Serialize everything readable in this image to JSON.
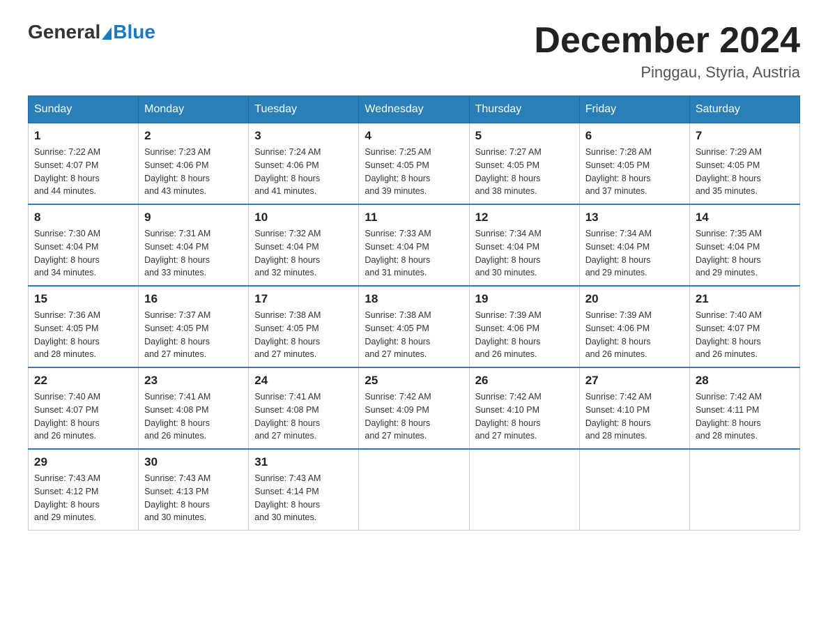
{
  "header": {
    "logo_general": "General",
    "logo_blue": "Blue",
    "month_title": "December 2024",
    "location": "Pinggau, Styria, Austria"
  },
  "days_of_week": [
    "Sunday",
    "Monday",
    "Tuesday",
    "Wednesday",
    "Thursday",
    "Friday",
    "Saturday"
  ],
  "weeks": [
    [
      {
        "day": "1",
        "sunrise": "7:22 AM",
        "sunset": "4:07 PM",
        "daylight": "8 hours and 44 minutes."
      },
      {
        "day": "2",
        "sunrise": "7:23 AM",
        "sunset": "4:06 PM",
        "daylight": "8 hours and 43 minutes."
      },
      {
        "day": "3",
        "sunrise": "7:24 AM",
        "sunset": "4:06 PM",
        "daylight": "8 hours and 41 minutes."
      },
      {
        "day": "4",
        "sunrise": "7:25 AM",
        "sunset": "4:05 PM",
        "daylight": "8 hours and 39 minutes."
      },
      {
        "day": "5",
        "sunrise": "7:27 AM",
        "sunset": "4:05 PM",
        "daylight": "8 hours and 38 minutes."
      },
      {
        "day": "6",
        "sunrise": "7:28 AM",
        "sunset": "4:05 PM",
        "daylight": "8 hours and 37 minutes."
      },
      {
        "day": "7",
        "sunrise": "7:29 AM",
        "sunset": "4:05 PM",
        "daylight": "8 hours and 35 minutes."
      }
    ],
    [
      {
        "day": "8",
        "sunrise": "7:30 AM",
        "sunset": "4:04 PM",
        "daylight": "8 hours and 34 minutes."
      },
      {
        "day": "9",
        "sunrise": "7:31 AM",
        "sunset": "4:04 PM",
        "daylight": "8 hours and 33 minutes."
      },
      {
        "day": "10",
        "sunrise": "7:32 AM",
        "sunset": "4:04 PM",
        "daylight": "8 hours and 32 minutes."
      },
      {
        "day": "11",
        "sunrise": "7:33 AM",
        "sunset": "4:04 PM",
        "daylight": "8 hours and 31 minutes."
      },
      {
        "day": "12",
        "sunrise": "7:34 AM",
        "sunset": "4:04 PM",
        "daylight": "8 hours and 30 minutes."
      },
      {
        "day": "13",
        "sunrise": "7:34 AM",
        "sunset": "4:04 PM",
        "daylight": "8 hours and 29 minutes."
      },
      {
        "day": "14",
        "sunrise": "7:35 AM",
        "sunset": "4:04 PM",
        "daylight": "8 hours and 29 minutes."
      }
    ],
    [
      {
        "day": "15",
        "sunrise": "7:36 AM",
        "sunset": "4:05 PM",
        "daylight": "8 hours and 28 minutes."
      },
      {
        "day": "16",
        "sunrise": "7:37 AM",
        "sunset": "4:05 PM",
        "daylight": "8 hours and 27 minutes."
      },
      {
        "day": "17",
        "sunrise": "7:38 AM",
        "sunset": "4:05 PM",
        "daylight": "8 hours and 27 minutes."
      },
      {
        "day": "18",
        "sunrise": "7:38 AM",
        "sunset": "4:05 PM",
        "daylight": "8 hours and 27 minutes."
      },
      {
        "day": "19",
        "sunrise": "7:39 AM",
        "sunset": "4:06 PM",
        "daylight": "8 hours and 26 minutes."
      },
      {
        "day": "20",
        "sunrise": "7:39 AM",
        "sunset": "4:06 PM",
        "daylight": "8 hours and 26 minutes."
      },
      {
        "day": "21",
        "sunrise": "7:40 AM",
        "sunset": "4:07 PM",
        "daylight": "8 hours and 26 minutes."
      }
    ],
    [
      {
        "day": "22",
        "sunrise": "7:40 AM",
        "sunset": "4:07 PM",
        "daylight": "8 hours and 26 minutes."
      },
      {
        "day": "23",
        "sunrise": "7:41 AM",
        "sunset": "4:08 PM",
        "daylight": "8 hours and 26 minutes."
      },
      {
        "day": "24",
        "sunrise": "7:41 AM",
        "sunset": "4:08 PM",
        "daylight": "8 hours and 27 minutes."
      },
      {
        "day": "25",
        "sunrise": "7:42 AM",
        "sunset": "4:09 PM",
        "daylight": "8 hours and 27 minutes."
      },
      {
        "day": "26",
        "sunrise": "7:42 AM",
        "sunset": "4:10 PM",
        "daylight": "8 hours and 27 minutes."
      },
      {
        "day": "27",
        "sunrise": "7:42 AM",
        "sunset": "4:10 PM",
        "daylight": "8 hours and 28 minutes."
      },
      {
        "day": "28",
        "sunrise": "7:42 AM",
        "sunset": "4:11 PM",
        "daylight": "8 hours and 28 minutes."
      }
    ],
    [
      {
        "day": "29",
        "sunrise": "7:43 AM",
        "sunset": "4:12 PM",
        "daylight": "8 hours and 29 minutes."
      },
      {
        "day": "30",
        "sunrise": "7:43 AM",
        "sunset": "4:13 PM",
        "daylight": "8 hours and 30 minutes."
      },
      {
        "day": "31",
        "sunrise": "7:43 AM",
        "sunset": "4:14 PM",
        "daylight": "8 hours and 30 minutes."
      },
      null,
      null,
      null,
      null
    ]
  ],
  "labels": {
    "sunrise": "Sunrise:",
    "sunset": "Sunset:",
    "daylight": "Daylight:"
  }
}
